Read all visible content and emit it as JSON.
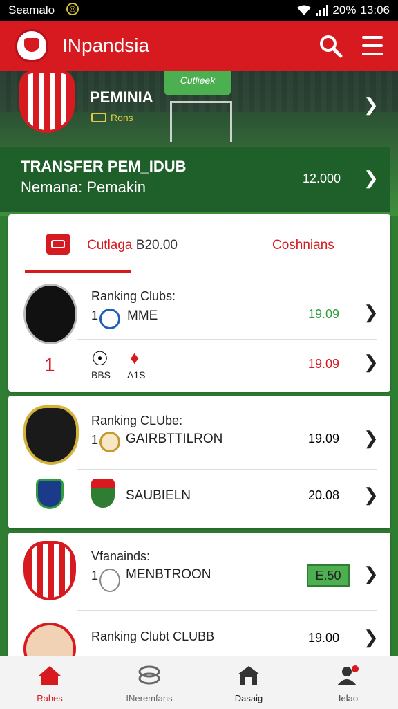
{
  "status_bar": {
    "carrier": "Seamalo",
    "battery": "20%",
    "time": "13:06"
  },
  "app_bar": {
    "title": "INpandsia"
  },
  "hero": {
    "club_title": "PEMINIA",
    "club_sub": "Rons",
    "badge": "Cutlieek",
    "transfer_title": "TRANSFER PEM_IDUB",
    "transfer_sub": "Nemana: Pemakin",
    "transfer_value": "12.000"
  },
  "tabs": {
    "left_label": "Cutlaga",
    "left_value": "B20.00",
    "right_label": "Coshnians"
  },
  "cards": [
    {
      "rows": [
        {
          "heading": "Ranking Clubs:",
          "rank": "1",
          "name": "MME",
          "value": "19.09",
          "value_color": "#2e9e3a"
        },
        {
          "rank": "1",
          "left_label": "BBS",
          "right_label": "A1S",
          "value": "19.09",
          "value_color": "#d71920"
        }
      ]
    },
    {
      "rows": [
        {
          "heading": "Ranking CLUbe:",
          "rank": "1",
          "name": "GAIRBTTILRON",
          "value": "19.09",
          "value_color": "#222222"
        },
        {
          "name": "SAUBIELN",
          "value": "20.08",
          "value_color": "#222222"
        }
      ]
    },
    {
      "rows": [
        {
          "heading": "Vfanainds:",
          "rank": "1",
          "name": "MENBTROON",
          "value": "E.50",
          "value_color": "#222222"
        },
        {
          "heading": "Ranking Clubt CLUBB",
          "value": "19.00",
          "value_color": "#222222"
        }
      ]
    }
  ],
  "bottom_nav": [
    {
      "label": "Rahes",
      "icon": "home-icon",
      "active": true
    },
    {
      "label": "INeremfans",
      "icon": "transfers-icon",
      "active": false
    },
    {
      "label": "Dasaig",
      "icon": "barn-icon",
      "active": false
    },
    {
      "label": "Ielao",
      "icon": "profile-icon",
      "active": false
    }
  ],
  "colors": {
    "brand_red": "#d71920",
    "green": "#2e9e3a",
    "dark_green": "#1e5f2a"
  }
}
